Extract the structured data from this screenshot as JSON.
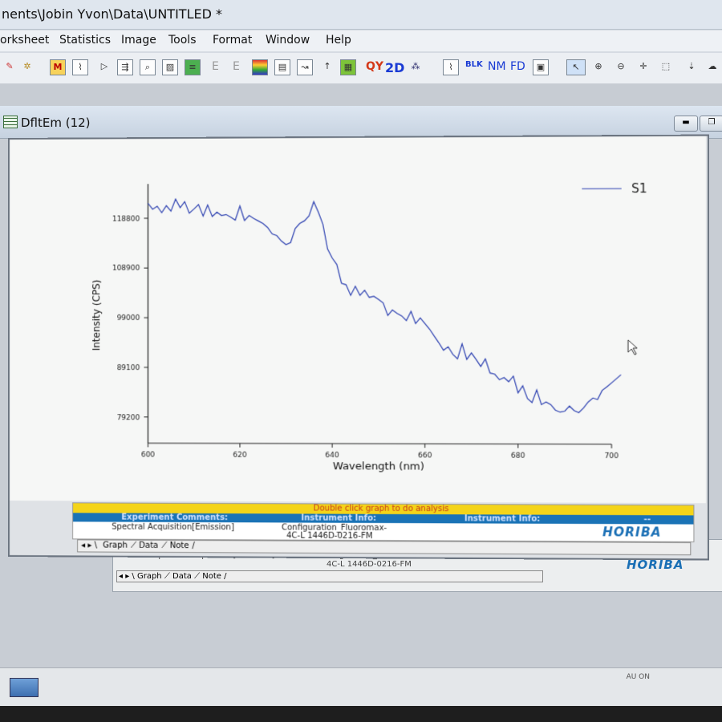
{
  "app": {
    "title": "nents\\Jobin Yvon\\Data\\UNTITLED *"
  },
  "menu": [
    "orksheet",
    "Statistics",
    "Image",
    "Tools",
    "Format",
    "Window",
    "Help"
  ],
  "toolbar": {
    "text_buttons": [
      "E",
      "E",
      "QY",
      "2D",
      "BLK",
      "NM",
      "FD"
    ]
  },
  "window": {
    "title": "DfltEm (12)"
  },
  "chart_data": {
    "type": "line",
    "xlabel": "Wavelength (nm)",
    "ylabel": "Intensity (CPS)",
    "xlim": [
      600,
      700
    ],
    "ylim": [
      74000,
      125000
    ],
    "x_ticks": [
      "600",
      "620",
      "640",
      "660",
      "680",
      "700"
    ],
    "y_ticks": [
      "118800",
      "108900",
      "99000",
      "89100",
      "79200"
    ],
    "legend": "top-right",
    "series": [
      {
        "name": "S1",
        "color": "#2b3fb0",
        "x": [
          600,
          601,
          602,
          603,
          604,
          605,
          606,
          607,
          608,
          609,
          610,
          611,
          612,
          613,
          614,
          615,
          616,
          617,
          618,
          619,
          620,
          621,
          622,
          623,
          624,
          625,
          626,
          627,
          628,
          629,
          630,
          631,
          632,
          633,
          634,
          635,
          636,
          637,
          638,
          639,
          640,
          641,
          642,
          643,
          644,
          645,
          646,
          647,
          648,
          649,
          650,
          651,
          652,
          653,
          654,
          655,
          656,
          657,
          658,
          659,
          660,
          661,
          662,
          663,
          664,
          665,
          666,
          667,
          668,
          669,
          670,
          671,
          672,
          673,
          674,
          675,
          676,
          677,
          678,
          679,
          680,
          681,
          682,
          683,
          684,
          685,
          686,
          687,
          688,
          689,
          690,
          691,
          692,
          693,
          694,
          695,
          696,
          697,
          698,
          699,
          700,
          701,
          702
        ],
        "values": [
          121800,
          120600,
          121200,
          119900,
          121300,
          120200,
          122600,
          120900,
          122100,
          119800,
          120600,
          121500,
          119200,
          121400,
          119100,
          120000,
          119300,
          119500,
          119000,
          118400,
          121200,
          118300,
          119300,
          118700,
          118200,
          117700,
          116900,
          115600,
          115300,
          114200,
          113500,
          113900,
          116700,
          117700,
          118200,
          119200,
          122000,
          119900,
          117500,
          112600,
          110800,
          109500,
          105800,
          105500,
          103400,
          105200,
          103400,
          104400,
          103000,
          103200,
          102600,
          101900,
          99400,
          100500,
          99800,
          99300,
          98400,
          100200,
          97800,
          98900,
          97800,
          96700,
          95300,
          94000,
          92500,
          93200,
          91700,
          90800,
          93800,
          90700,
          92000,
          90700,
          89300,
          90800,
          88000,
          87800,
          86700,
          87100,
          86300,
          87400,
          84100,
          85500,
          83000,
          82200,
          84700,
          81800,
          82300,
          81800,
          80700,
          80300,
          80500,
          81500,
          80600,
          80200,
          81100,
          82300,
          83100,
          82800,
          84600,
          85300,
          86100,
          86900,
          87700
        ]
      }
    ]
  },
  "info_panel": {
    "banner": "Double click graph to do analysis",
    "col1_header": "Experiment Comments:",
    "col2_header": "Instrument Info:",
    "col3_header": "Instrument Info:",
    "col4_header": "--",
    "comment": "Spectral Acquisition[Emission]",
    "config_line1": "Configuration_Fluoromax-",
    "config_line2": "4C-L  1446D-0216-FM",
    "brand": "HORIBA"
  },
  "tabs": [
    "Graph",
    "Data",
    "Note"
  ],
  "back_panel": {
    "comment": "Spectral Acquisition[Emission]",
    "config_line1": "Configuration_Fluoromax-",
    "config_line2": "4C-L  1446D-0216-FM",
    "brand": "HORIBA",
    "tabs": [
      "Graph",
      "Data",
      "Note"
    ]
  },
  "status": {
    "text": "AU  ON"
  }
}
